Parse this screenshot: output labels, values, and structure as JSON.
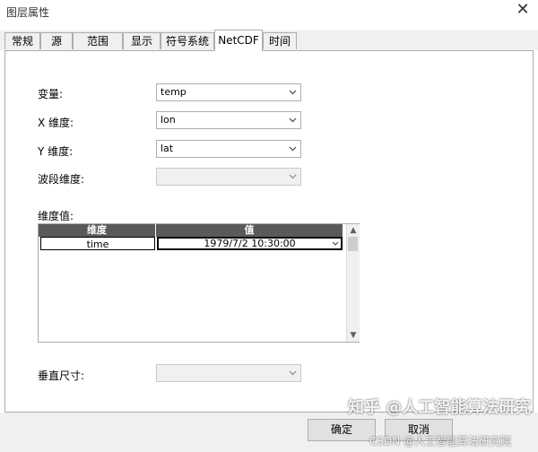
{
  "window": {
    "title": "图层属性"
  },
  "tabs": [
    {
      "label": "常规"
    },
    {
      "label": "源"
    },
    {
      "label": "范围"
    },
    {
      "label": "显示"
    },
    {
      "label": "符号系统"
    },
    {
      "label": "NetCDF"
    },
    {
      "label": "时间"
    }
  ],
  "active_tab": "NetCDF",
  "netcdf": {
    "variable": {
      "label": "变量:",
      "value": "temp"
    },
    "x_dimension": {
      "label": "X 维度:",
      "value": "lon"
    },
    "y_dimension": {
      "label": "Y 维度:",
      "value": "lat"
    },
    "band_dimension": {
      "label": "波段维度:",
      "value": ""
    },
    "dimension_values": {
      "label": "维度值:",
      "columns": [
        "维度",
        "值"
      ],
      "rows": [
        {
          "dimension": "time",
          "value": "1979/7/2 10:30:00"
        }
      ]
    },
    "vertical_size": {
      "label": "垂直尺寸:",
      "value": ""
    }
  },
  "buttons": {
    "ok": "确定",
    "cancel": "取消"
  },
  "watermark": {
    "line1": "知乎 @人工智能算法研究",
    "line2": "CSDN @人工智能算法研究院"
  }
}
